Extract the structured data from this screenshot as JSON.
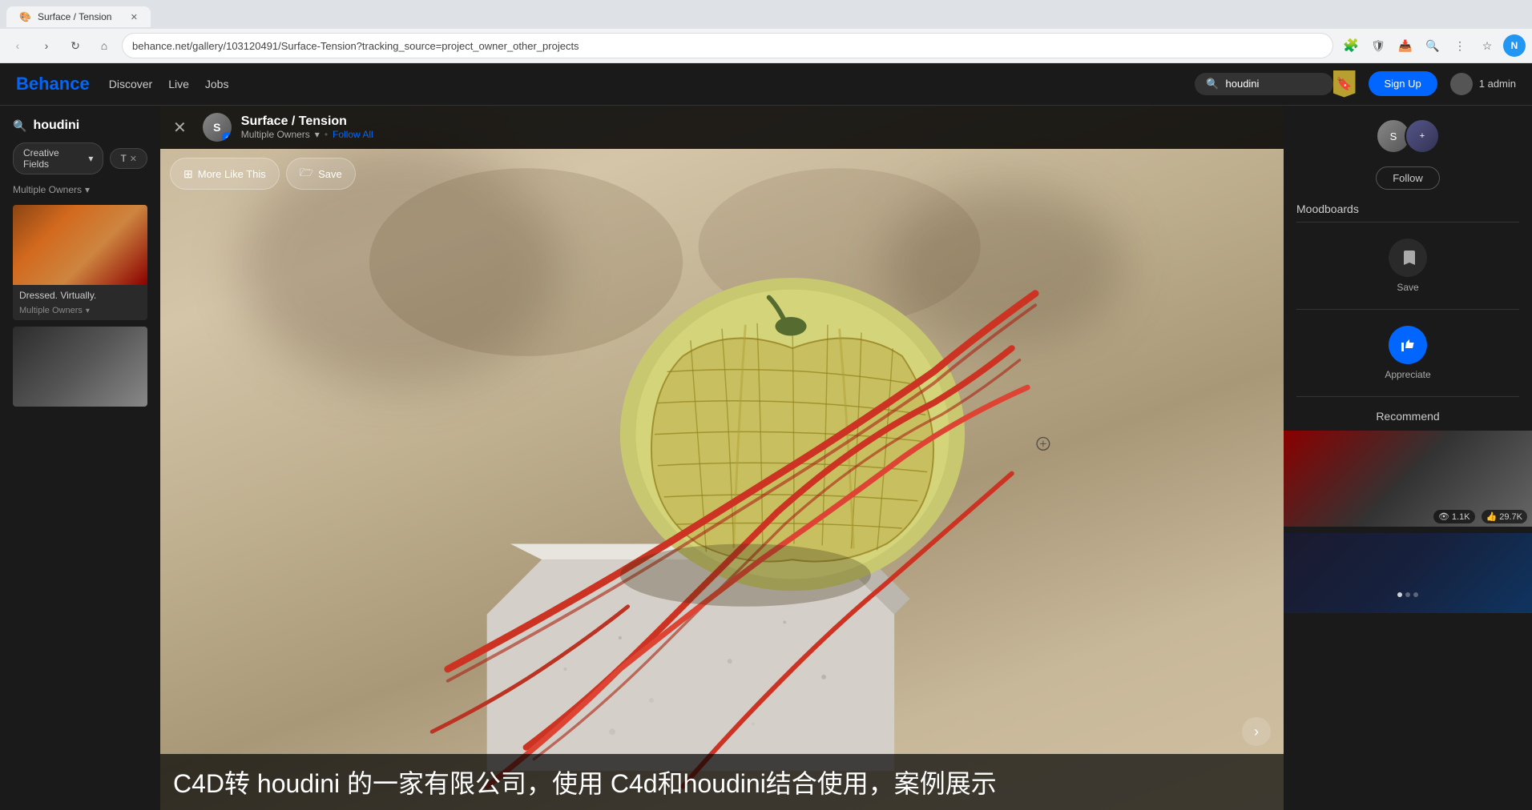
{
  "browser": {
    "tab_title": "Surface / Tension",
    "url": "behance.net/gallery/103120491/Surface-Tension?tracking_source=project_owner_other_projects",
    "back_disabled": false,
    "forward_disabled": false,
    "profile_initial": "N"
  },
  "behance_header": {
    "logo": "Behance",
    "nav_items": [
      "Discover",
      "Live",
      "Jobs"
    ],
    "search_value": "houdini",
    "search_placeholder": "Search",
    "bookmark_icon": "🔖",
    "signup_label": "Sign Up",
    "user_label": "1 admin"
  },
  "project": {
    "title": "Surface / Tension",
    "owner_name": "Multiple Owners",
    "follow_label": "Follow All",
    "close_icon": "✕"
  },
  "action_bar": {
    "more_like_this_label": "More Like This",
    "save_label": "Save"
  },
  "left_sidebar": {
    "search_icon": "🔍",
    "search_query": "houdini",
    "filter1_label": "Creative Fields",
    "filter2_label": "T",
    "owner_label": "Multiple Owners",
    "card1_title": "Dressed. Virtually.",
    "card1_owner": "Multiple Owners",
    "card2_title": ""
  },
  "right_sidebar": {
    "follow_label": "Follow",
    "moodboards_label": "Moodboards",
    "save_label": "Save",
    "appreciate_label": "Appreciate",
    "recommend_label": "Recommend",
    "next_arrow": "›",
    "stat1_value": "1.1K",
    "stat2_value": "29.7K"
  },
  "image": {
    "watermark_text": "C4D转 houdini 的一家有限公司，使用 C4d和houdini结合使用，案例展示"
  }
}
